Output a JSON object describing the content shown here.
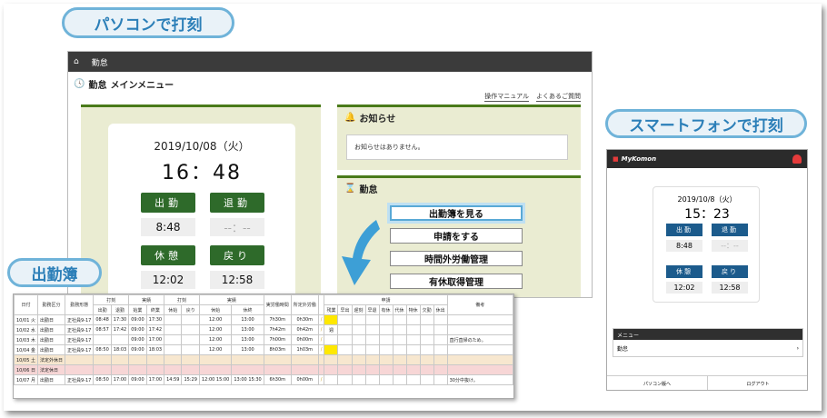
{
  "labels": {
    "pc": "パソコンで打刻",
    "smartphone": "スマートフォンで打刻",
    "attendance_book": "出勤簿"
  },
  "pc": {
    "nav_title": "勤怠",
    "page_title_app": "勤怠",
    "page_title_menu": "メインメニュー",
    "link_manual": "操作マニュアル",
    "link_faq": "よくあるご質問",
    "date": "2019/10/08（火）",
    "time": "16：48",
    "buttons": {
      "clock_in": "出勤",
      "clock_out": "退勤",
      "break": "休憩",
      "return": "戻り"
    },
    "values": {
      "clock_in": "8:48",
      "clock_out": "--：--",
      "break": "12:02",
      "return": "12:58"
    },
    "notice_title": "お知らせ",
    "notice_text": "お知らせはありません。",
    "attendance_title": "勤怠",
    "actions": [
      "出勤簿を見る",
      "申請をする",
      "時間外労働管理",
      "有休取得管理"
    ]
  },
  "book": {
    "header1": [
      "日付",
      "勤務区分",
      "勤務形態",
      "打刻",
      "実績",
      "打刻",
      "実績",
      "実労働時間",
      "所定外労働",
      "",
      "申請",
      "備考"
    ],
    "header2": [
      "出勤",
      "退勤",
      "始業",
      "終業",
      "休始",
      "戻り",
      "休始",
      "休終",
      "残業",
      "早出",
      "遅刻",
      "早退",
      "有休",
      "代休",
      "特休",
      "欠勤",
      "休出"
    ],
    "rows": [
      {
        "date": "10/01 火",
        "kubun": "出勤日",
        "keitai": "正社員9-17",
        "in": "08:48",
        "out": "17:30",
        "start": "09:00",
        "end": "17:30",
        "bs": "",
        "br": "",
        "rs": "12:00",
        "re": "13:00",
        "work": "7h30m",
        "ot": "0h30m",
        "flag": "y",
        "note": ""
      },
      {
        "date": "10/02 水",
        "kubun": "出勤日",
        "keitai": "正社員9-17",
        "in": "08:57",
        "out": "17:42",
        "start": "09:00",
        "end": "17:42",
        "bs": "",
        "br": "",
        "rs": "12:00",
        "re": "13:00",
        "work": "7h42m",
        "ot": "0h42m",
        "flag": "週",
        "note": ""
      },
      {
        "date": "10/03 木",
        "kubun": "出勤日",
        "keitai": "正社員9-17",
        "in": "",
        "out": "",
        "start": "09:00",
        "end": "17:00",
        "bs": "",
        "br": "",
        "rs": "12:00",
        "re": "13:00",
        "work": "7h00m",
        "ot": "0h00m",
        "flag": "",
        "note": "直行直帰のため。"
      },
      {
        "date": "10/04 金",
        "kubun": "出勤日",
        "keitai": "正社員9-17",
        "in": "08:50",
        "out": "18:03",
        "start": "09:00",
        "end": "18:03",
        "bs": "",
        "br": "",
        "rs": "12:00",
        "re": "13:00",
        "work": "8h03m",
        "ot": "1h03m",
        "flag": "y",
        "note": ""
      },
      {
        "date": "10/05 土",
        "kubun": "法定外休日",
        "keitai": "",
        "in": "",
        "out": "",
        "start": "",
        "end": "",
        "bs": "",
        "br": "",
        "rs": "",
        "re": "",
        "work": "",
        "ot": "",
        "flag": "",
        "note": ""
      },
      {
        "date": "10/06 日",
        "kubun": "法定休日",
        "keitai": "",
        "in": "",
        "out": "",
        "start": "",
        "end": "",
        "bs": "",
        "br": "",
        "rs": "",
        "re": "",
        "work": "",
        "ot": "",
        "flag": "",
        "note": ""
      },
      {
        "date": "10/07 月",
        "kubun": "出勤日",
        "keitai": "正社員9-17",
        "in": "08:50",
        "out": "17:00",
        "start": "09:00",
        "end": "17:00",
        "bs": "14:59",
        "br": "15:29",
        "rs": "12:00 15:00",
        "re": "13:00 15:30",
        "work": "6h30m",
        "ot": "0h00m",
        "flag": "",
        "note": "30分中抜け。"
      }
    ]
  },
  "sp": {
    "logo": "MyKomon",
    "date": "2019/10/8（火）",
    "time": "15：23",
    "buttons": {
      "clock_in": "出勤",
      "clock_out": "退勤",
      "break": "休憩",
      "return": "戻り"
    },
    "values": {
      "clock_in": "8:48",
      "clock_out": "--：--",
      "break": "12:02",
      "return": "12:58"
    },
    "menu_title": "メニュー",
    "menu_item": "勤怠",
    "footer_left": "パソコン版へ",
    "footer_right": "ログアウト"
  },
  "colors": {
    "pill_border": "#6fb3d9",
    "pc_green": "#2e6a2a",
    "sp_blue": "#1c5b8c",
    "highlight": "#ffe800"
  }
}
